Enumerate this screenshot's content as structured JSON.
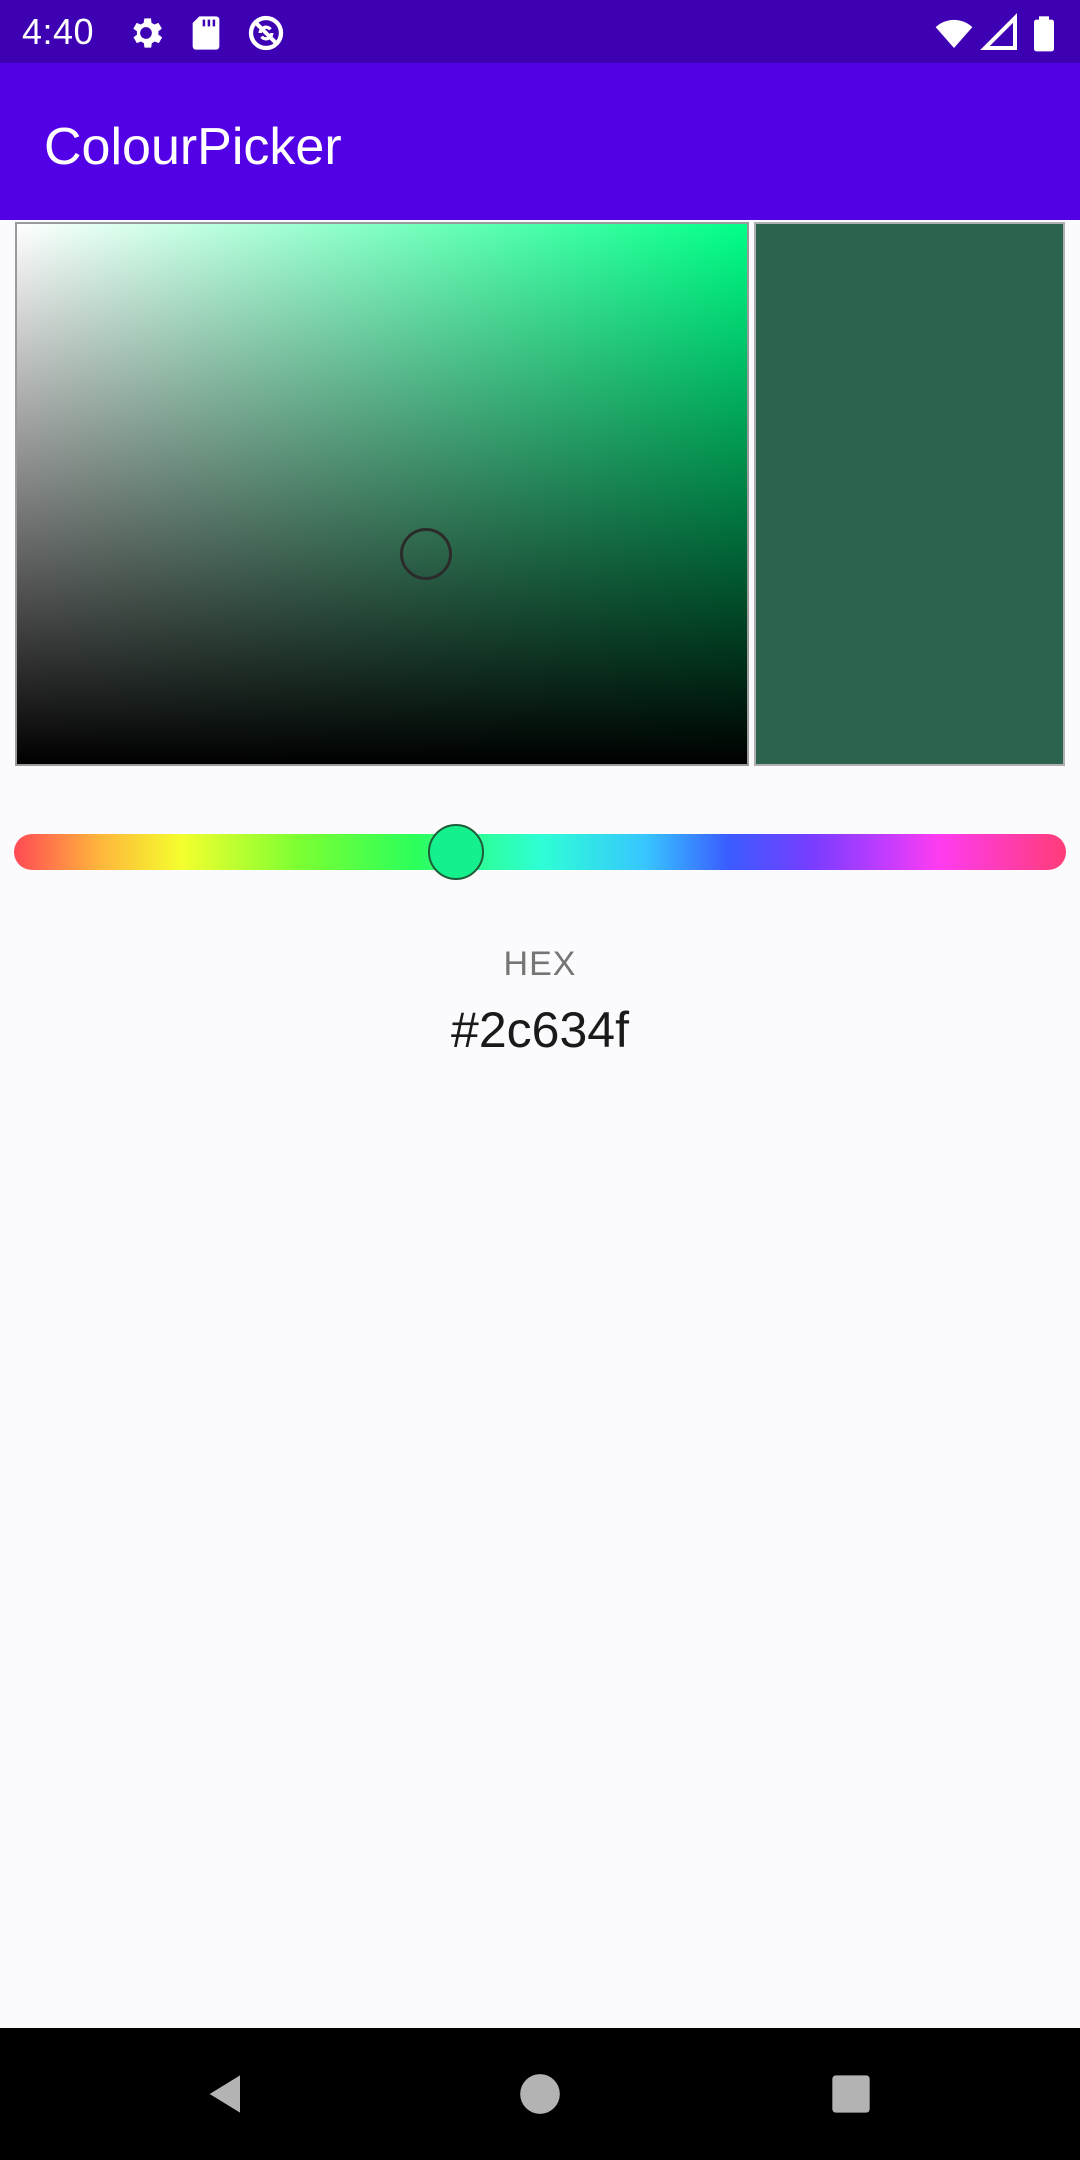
{
  "status_bar": {
    "time": "4:40",
    "icons_left": [
      "gear-icon",
      "sd-card-icon",
      "no-sync-icon"
    ],
    "icons_right": [
      "wifi-icon",
      "cell-signal-icon",
      "battery-icon"
    ]
  },
  "app_bar": {
    "title": "ColourPicker",
    "color": "#5200e6",
    "status_color": "#3e00b3"
  },
  "picker": {
    "hue_color": "#00ff88",
    "saturation": 0.56,
    "value": 0.39,
    "hue_position": 0.42,
    "thumb_color": "#14f08c"
  },
  "preview": {
    "color": "#2c634f"
  },
  "hex": {
    "label": "HEX",
    "value": "#2c634f"
  },
  "nav_bar": {
    "buttons": [
      "back-icon",
      "home-icon",
      "recents-icon"
    ]
  }
}
